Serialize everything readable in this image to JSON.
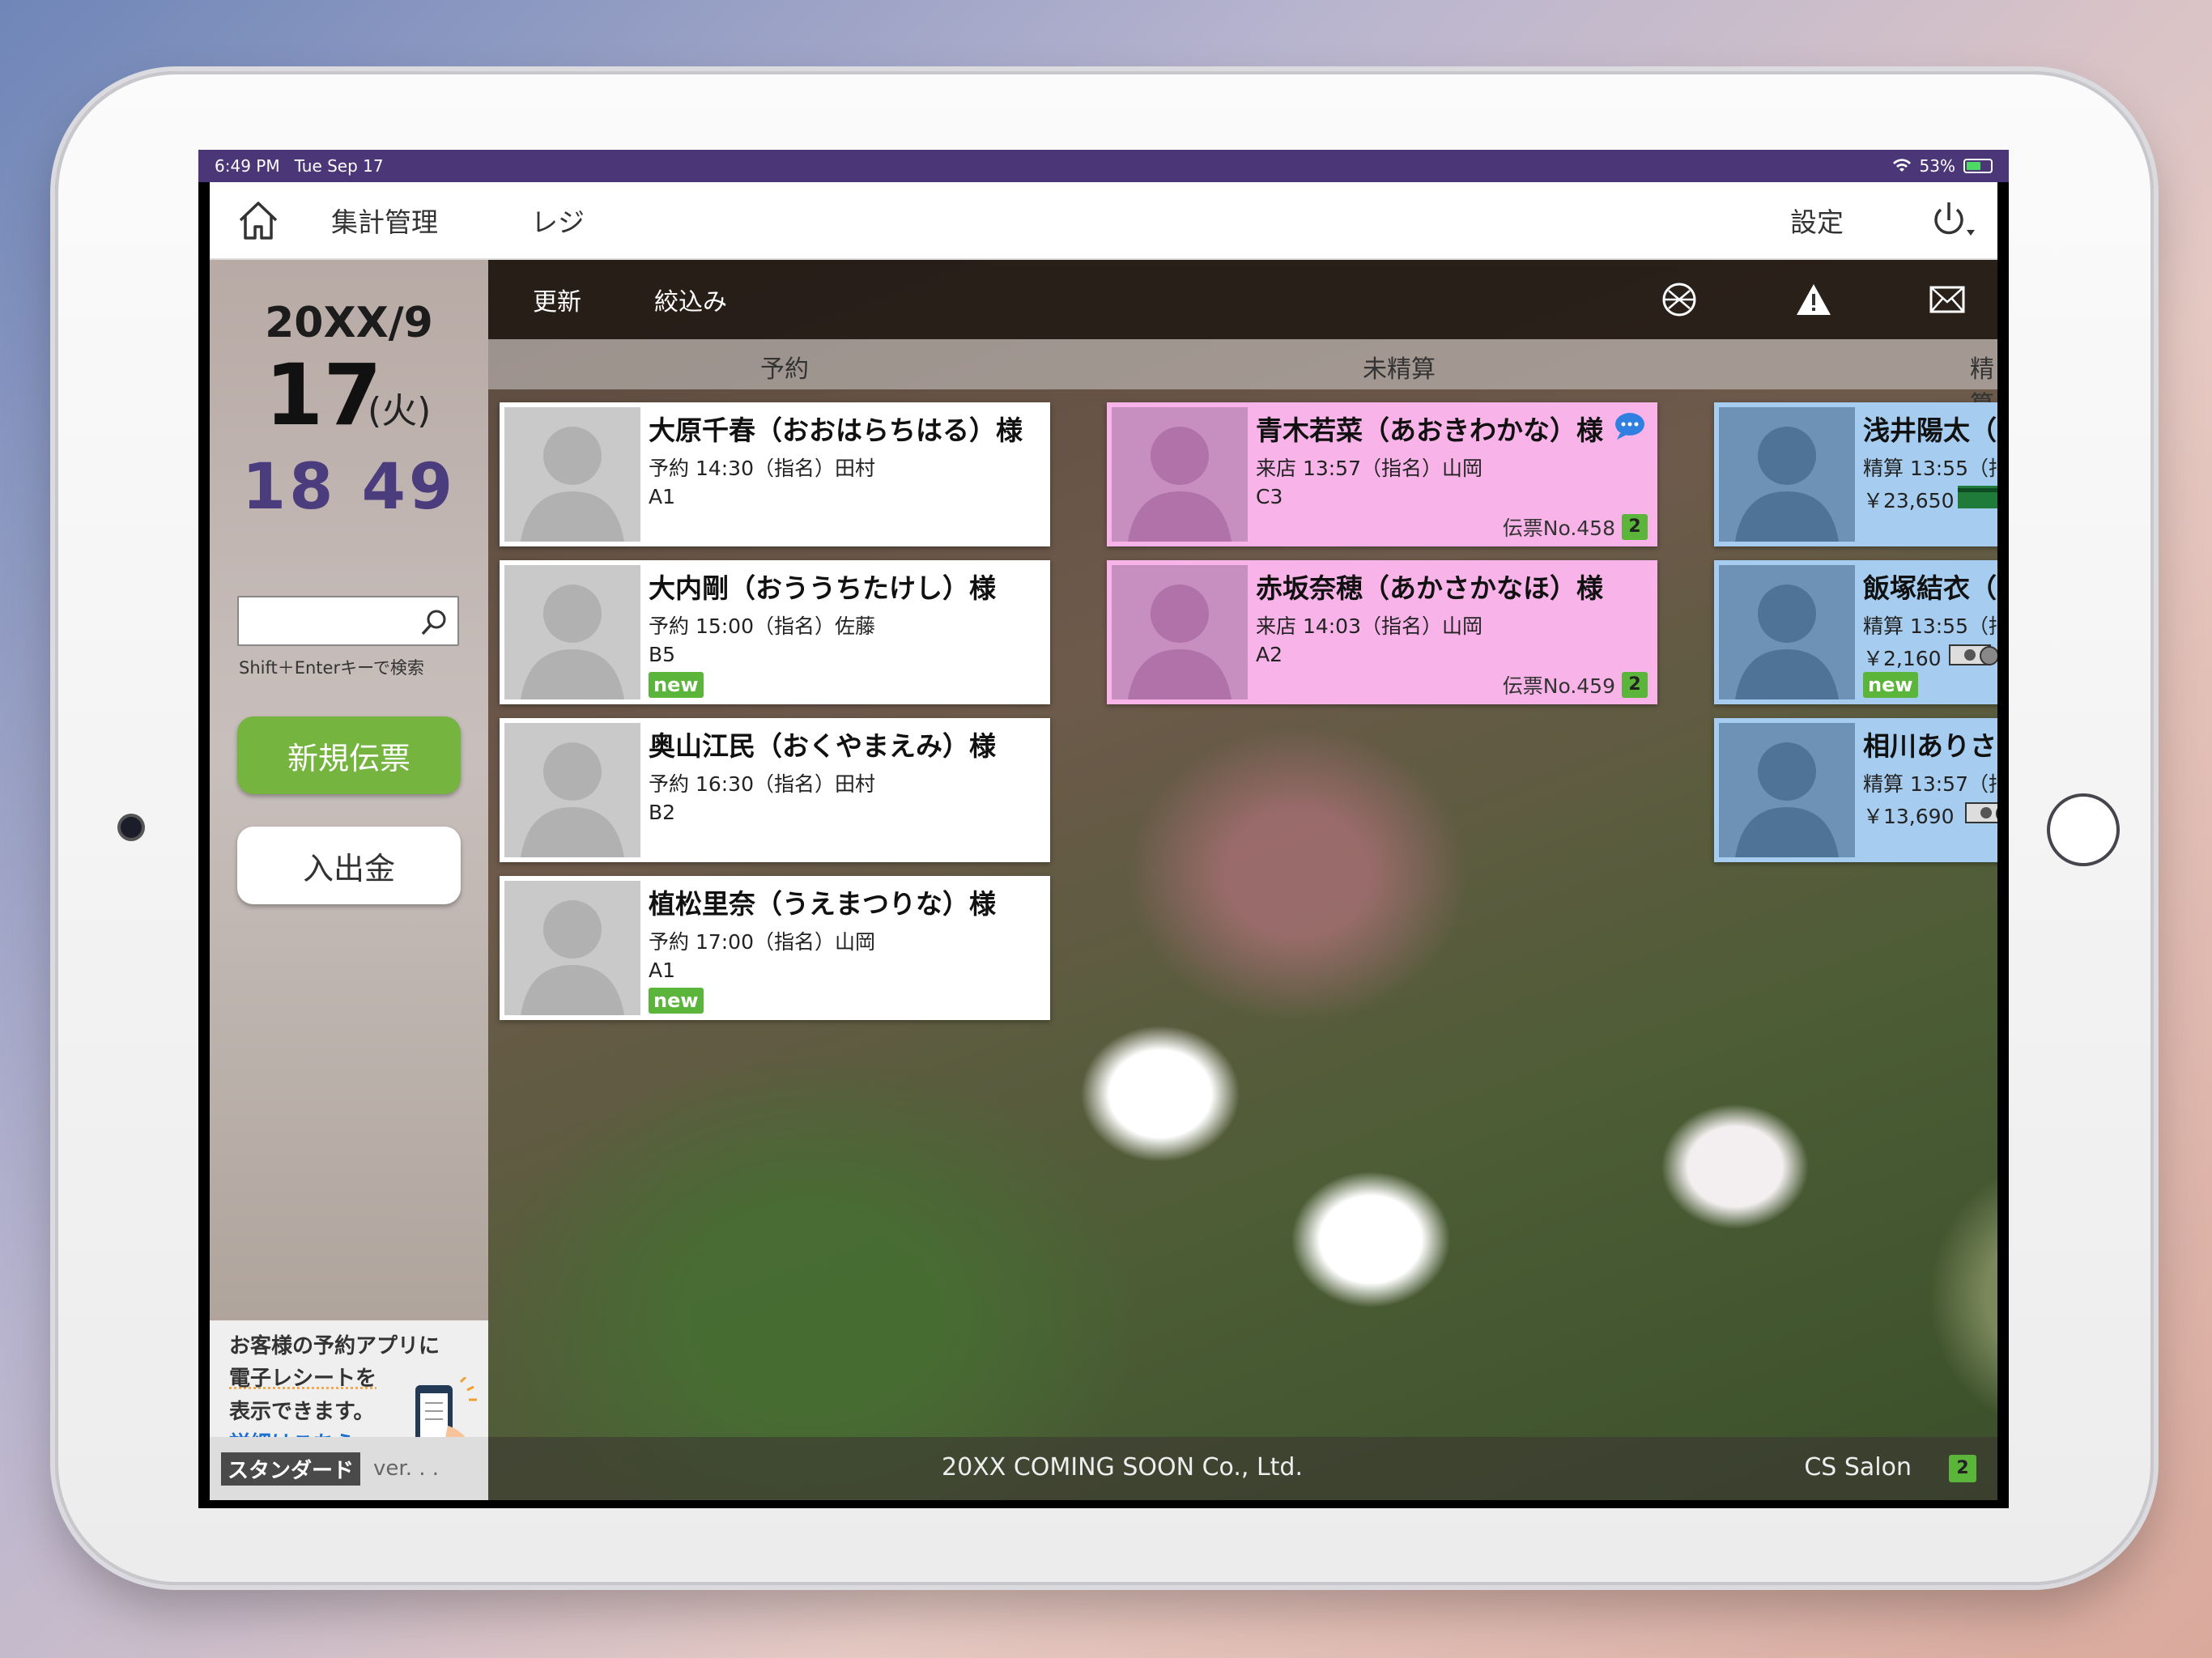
{
  "status": {
    "time": "6:49 PM",
    "date": "Tue Sep 17",
    "battery": "53%",
    "battery_level": 0.53
  },
  "nav": {
    "summary": "集計管理",
    "register": "レジ",
    "settings": "設定"
  },
  "sidebar": {
    "month": "20XX/9",
    "day": "17",
    "dow": "(火)",
    "clock": "18 49",
    "search_placeholder": "",
    "search_hint": "Shift＋Enterキーで検索",
    "new_slip": "新規伝票",
    "cash": "入出金",
    "promo_line1": "お客様の予約アプリに",
    "promo_line2": "電子レシートを",
    "promo_line3": "表示できます。",
    "promo_link": "詳細はこちら",
    "plan": "スタンダード",
    "version": "ver. . ."
  },
  "toolbar": {
    "refresh": "更新",
    "filter": "絞込み"
  },
  "columns": {
    "reserved": "予約",
    "unpaid": "未精算",
    "paid": "精算"
  },
  "reserved": [
    {
      "name": "大原千春（おおはらちはる）様",
      "line1": "予約 14:30（指名）田村",
      "line2": "A1",
      "new": ""
    },
    {
      "name": "大内剛（おううちたけし）様",
      "line1": "予約 15:00（指名）佐藤",
      "line2": "B5",
      "new": "new"
    },
    {
      "name": "奥山江民（おくやまえみ）様",
      "line1": "予約 16:30（指名）田村",
      "line2": "B2",
      "new": ""
    },
    {
      "name": "植松里奈（うえまつりな）様",
      "line1": "予約 17:00（指名）山岡",
      "line2": "A1",
      "new": "new"
    }
  ],
  "unpaid": [
    {
      "name": "青木若菜（あおきわかな）様",
      "line1": "来店 13:57（指名）山岡",
      "line2": "C3",
      "slip": "伝票No.458",
      "count": "2"
    },
    {
      "name": "赤坂奈穂（あかさかなほ）様",
      "line1": "来店 14:03（指名）山岡",
      "line2": "A2",
      "slip": "伝票No.459",
      "count": "2"
    }
  ],
  "paid": [
    {
      "name": "浅井陽太（",
      "line1": "精算 13:55（指",
      "line2": "￥23,650",
      "new": ""
    },
    {
      "name": "飯塚結衣（",
      "line1": "精算 13:55（指",
      "line2": "￥2,160",
      "new": "new"
    },
    {
      "name": "相川ありさ",
      "line1": "精算 13:57（指",
      "line2": "￥13,690",
      "new": ""
    }
  ],
  "footer": {
    "copyright": "20XX COMING SOON Co., Ltd.",
    "shop": "CS Salon",
    "count": "2"
  },
  "colors": {
    "status_bar": "#4b3677",
    "green": "#74b43f",
    "pink": "#f8b4e8",
    "blue": "#a6cdef"
  }
}
